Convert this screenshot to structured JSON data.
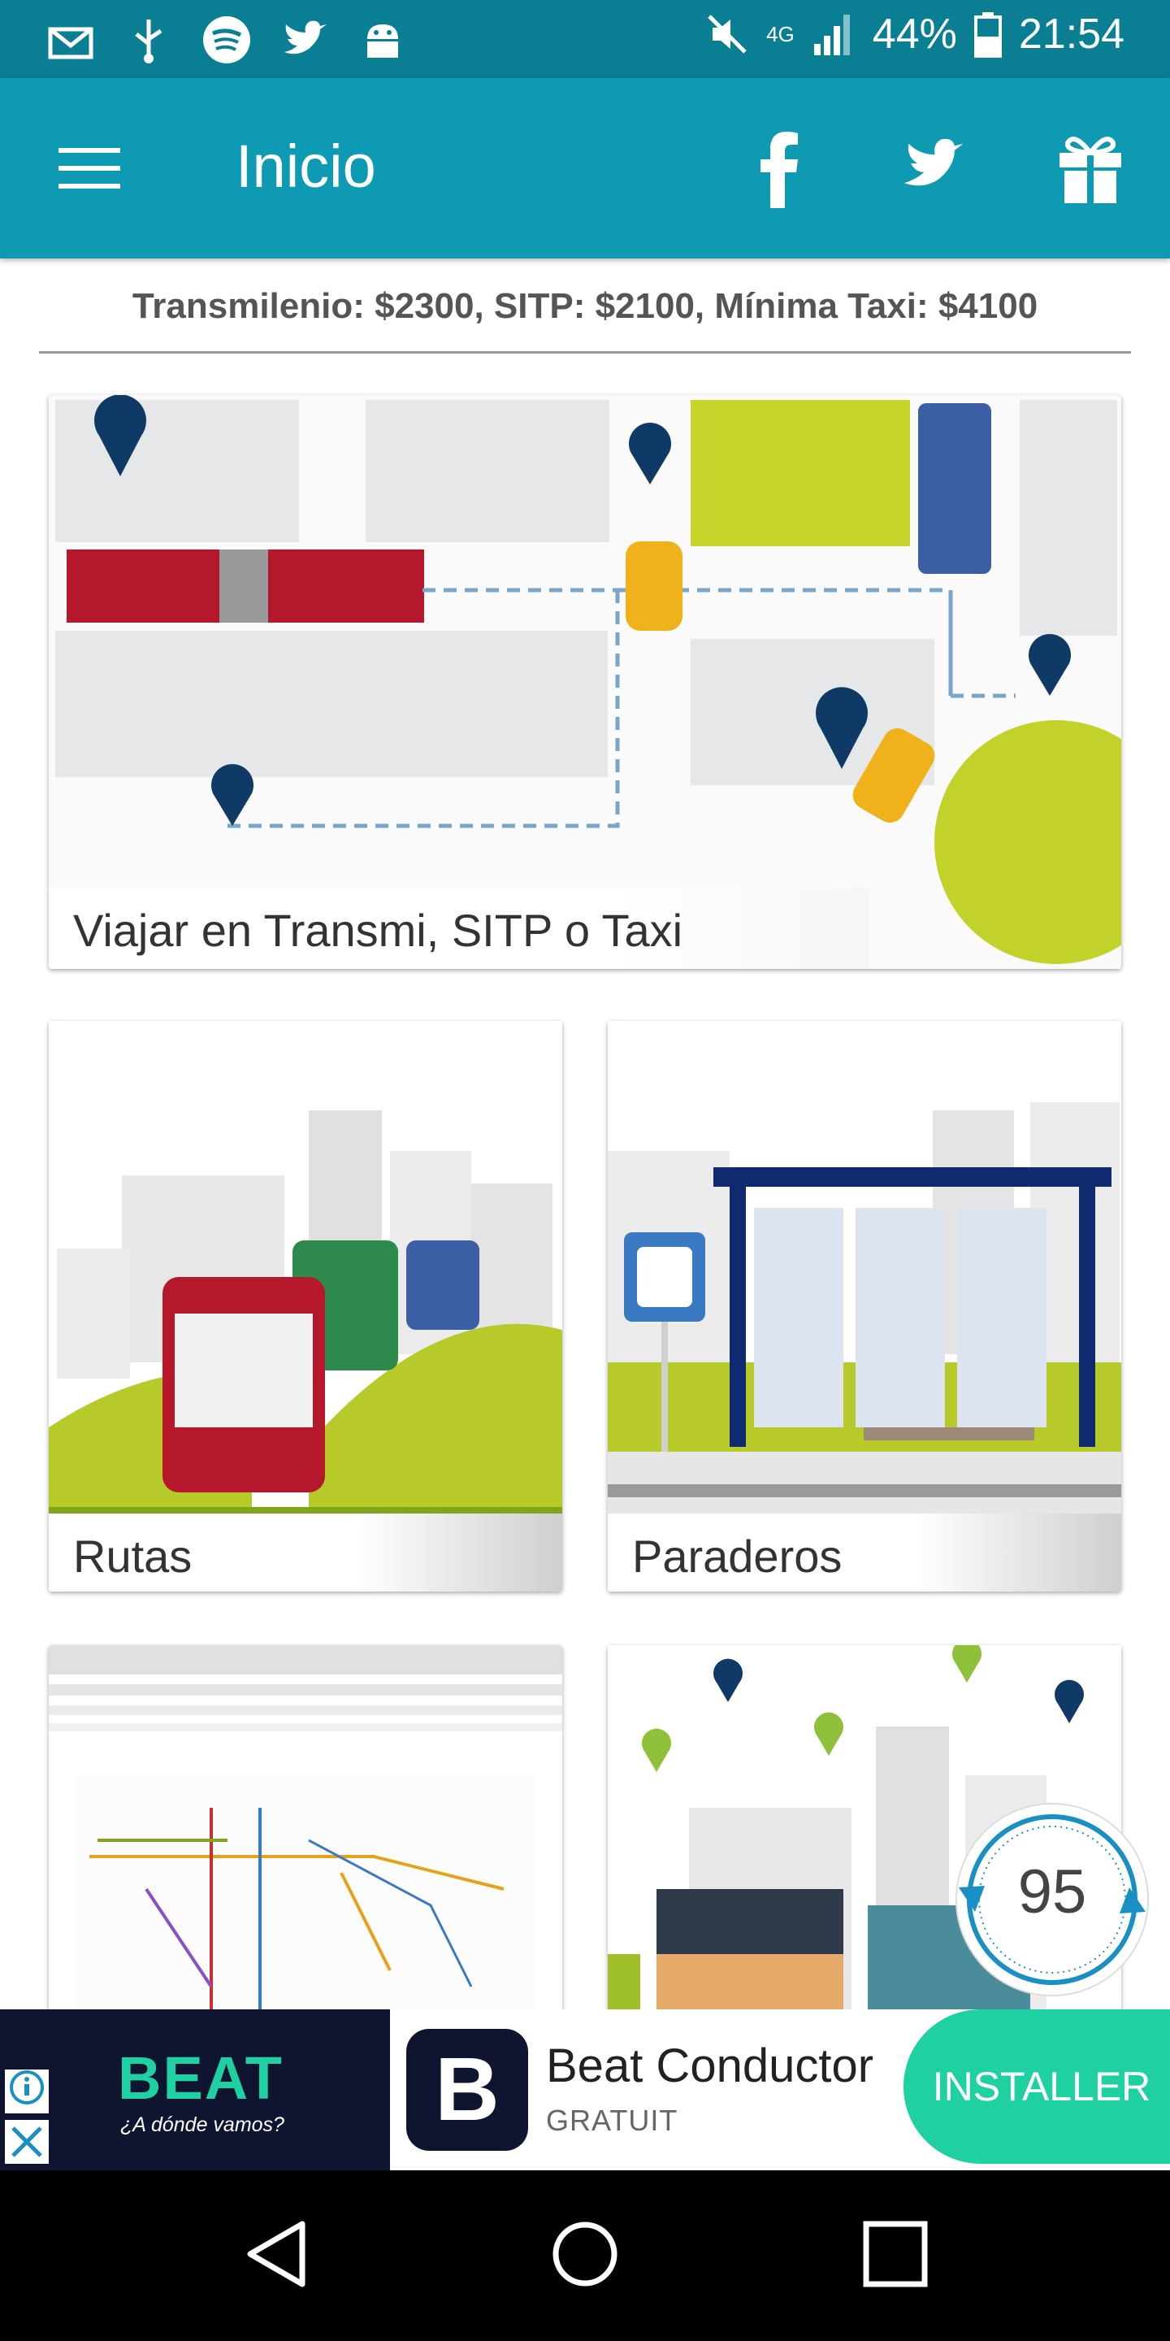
{
  "status_bar": {
    "battery": "44%",
    "time": "21:54",
    "network": "4G",
    "icons_left": [
      "mail-icon",
      "usb-icon",
      "spotify-icon",
      "twitter-icon",
      "android-icon"
    ],
    "icons_right": [
      "mute-icon",
      "data-arrows-icon",
      "signal-icon",
      "battery-icon"
    ]
  },
  "app_bar": {
    "title": "Inicio",
    "icons": [
      "menu-icon",
      "facebook-icon",
      "twitter-icon",
      "gift-icon"
    ],
    "color": "#0e9ab3"
  },
  "fare_info": "Transmilenio: $2300, SITP: $2100, Mínima Taxi: $4100",
  "cards": [
    {
      "label": "Viajar en Transmi, SITP o Taxi"
    },
    {
      "label": "Rutas"
    },
    {
      "label": "Paraderos"
    }
  ],
  "timer_badge": "95",
  "ad": {
    "brand": "BEAT",
    "brand_tagline": "¿A dónde vamos?",
    "app_icon_letter": "B",
    "app_name": "Beat Conductor",
    "app_price": "GRATUIT",
    "install_label": "INSTALLER",
    "accent": "#1fd1a2"
  },
  "nav_bar": {
    "icons": [
      "back-icon",
      "home-icon",
      "recents-icon"
    ]
  }
}
